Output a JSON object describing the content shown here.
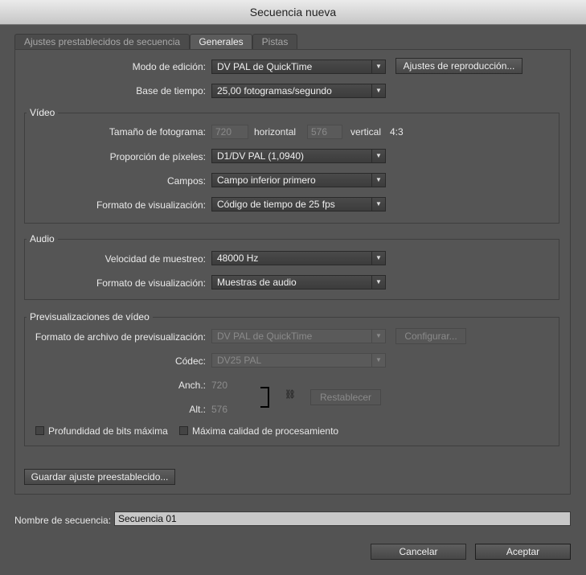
{
  "window": {
    "title": "Secuencia nueva"
  },
  "tabs": [
    {
      "label": "Ajustes prestablecidos de secuencia"
    },
    {
      "label": "Generales"
    },
    {
      "label": "Pistas"
    }
  ],
  "general": {
    "editing_mode": {
      "label": "Modo de edición:",
      "value": "DV PAL de QuickTime"
    },
    "playback_settings_button": "Ajustes de reproducción...",
    "timebase": {
      "label": "Base de tiempo:",
      "value": "25,00 fotogramas/segundo"
    }
  },
  "video": {
    "title": "Vídeo",
    "frame_size": {
      "label": "Tamaño de fotograma:",
      "horizontal_value": "720",
      "horizontal_label": "horizontal",
      "vertical_value": "576",
      "vertical_label": "vertical",
      "aspect": "4:3"
    },
    "pixel_aspect": {
      "label": "Proporción de píxeles:",
      "value": "D1/DV PAL (1,0940)"
    },
    "fields": {
      "label": "Campos:",
      "value": "Campo inferior primero"
    },
    "display_format": {
      "label": "Formato de visualización:",
      "value": "Código de tiempo de 25 fps"
    }
  },
  "audio": {
    "title": "Audio",
    "sample_rate": {
      "label": "Velocidad de muestreo:",
      "value": "48000 Hz"
    },
    "display_format": {
      "label": "Formato de visualización:",
      "value": "Muestras de audio"
    }
  },
  "preview": {
    "title": "Previsualizaciones de vídeo",
    "file_format": {
      "label": "Formato de archivo de previsualización:",
      "value": "DV PAL de QuickTime"
    },
    "configure_button": "Configurar...",
    "codec": {
      "label": "Códec:",
      "value": "DV25 PAL"
    },
    "width": {
      "label": "Anch.:",
      "value": "720"
    },
    "height": {
      "label": "Alt.:",
      "value": "576"
    },
    "reset_button": "Restablecer",
    "max_bit_depth": {
      "label": "Profundidad de bits máxima",
      "checked": false
    },
    "max_render_quality": {
      "label": "Máxima calidad de procesamiento",
      "checked": false
    }
  },
  "save_preset_button": "Guardar ajuste preestablecido...",
  "sequence_name": {
    "label": "Nombre de secuencia:",
    "value": "Secuencia 01"
  },
  "footer": {
    "cancel": "Cancelar",
    "ok": "Aceptar"
  }
}
